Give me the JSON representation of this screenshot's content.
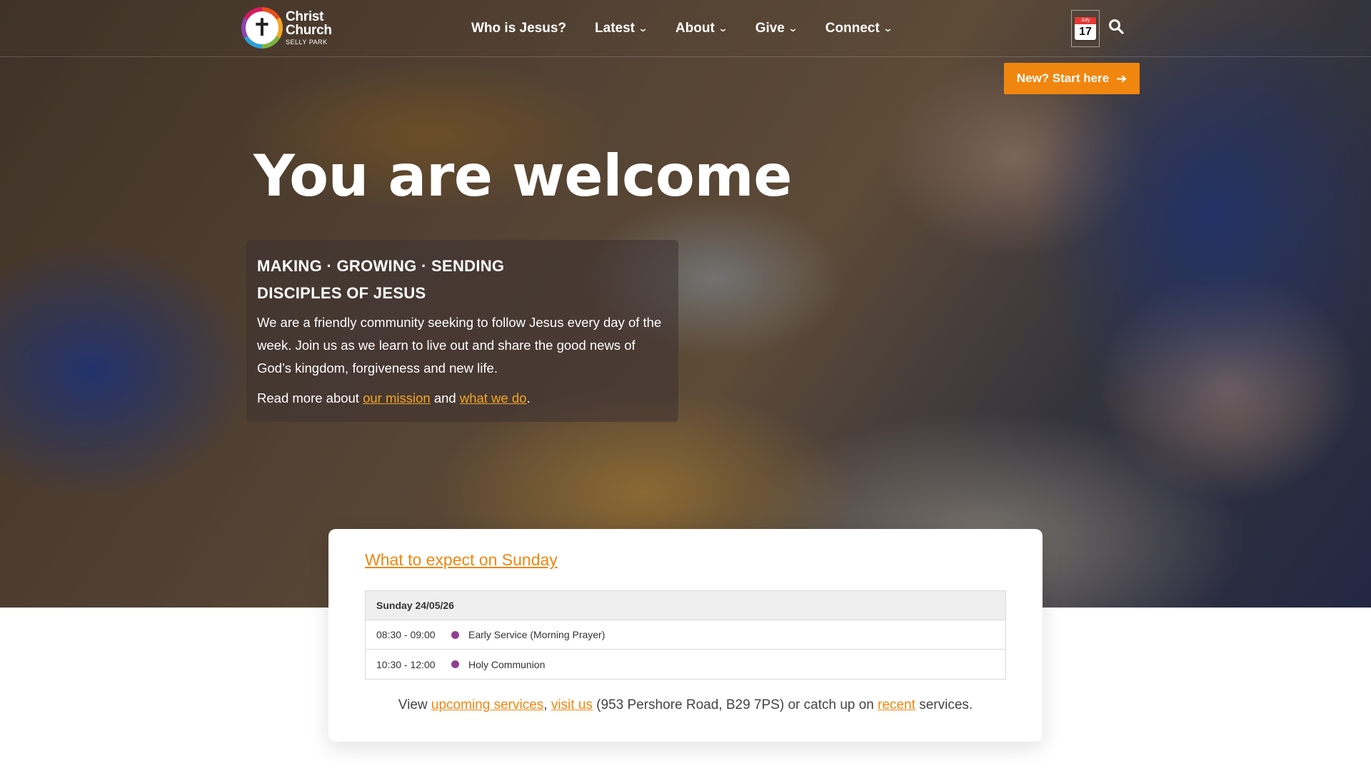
{
  "site": {
    "logo": {
      "line1": "Christ",
      "line2": "Church",
      "line3": "SELLY PARK",
      "icon": "cross-icon"
    },
    "colors": {
      "accent": "#f0860f",
      "event_dot": "#8e3f8f"
    }
  },
  "nav": {
    "items": [
      {
        "label": "Who is Jesus?",
        "dropdown": false
      },
      {
        "label": "Latest",
        "dropdown": true
      },
      {
        "label": "About",
        "dropdown": true
      },
      {
        "label": "Give",
        "dropdown": true
      },
      {
        "label": "Connect",
        "dropdown": true
      }
    ],
    "calendar": {
      "month": "July",
      "day": "17"
    },
    "search_icon": "search-icon"
  },
  "cta": {
    "label": "New? Start here",
    "icon": "arrow-right-icon"
  },
  "hero": {
    "title": "You are welcome",
    "heading_line1": "MAKING · GROWING · SENDING",
    "heading_line2": "DISCIPLES OF JESUS",
    "body": "We are a friendly community seeking to follow Jesus every day of the week. Join us as we learn to live out and share the good news of God’s kingdom, forgiveness and new life.",
    "more_prefix": "Read more about ",
    "link_mission": "our mission",
    "more_and": " and ",
    "link_what": "what we do",
    "more_suffix": "."
  },
  "sunday": {
    "title": "What to expect on Sunday",
    "date_header": "Sunday 24/05/26",
    "events": [
      {
        "time": "08:30 - 09:00",
        "name": "Early Service (Morning Prayer)"
      },
      {
        "time": "10:30 - 12:00",
        "name": "Holy Communion"
      }
    ],
    "footer": {
      "prefix": "View ",
      "link_upcoming": "upcoming services",
      "comma": ", ",
      "link_visit": "visit us",
      "address": " (953 Pershore Road, B29 7PS) or catch up on ",
      "link_recent": "recent",
      "suffix": " services."
    }
  }
}
